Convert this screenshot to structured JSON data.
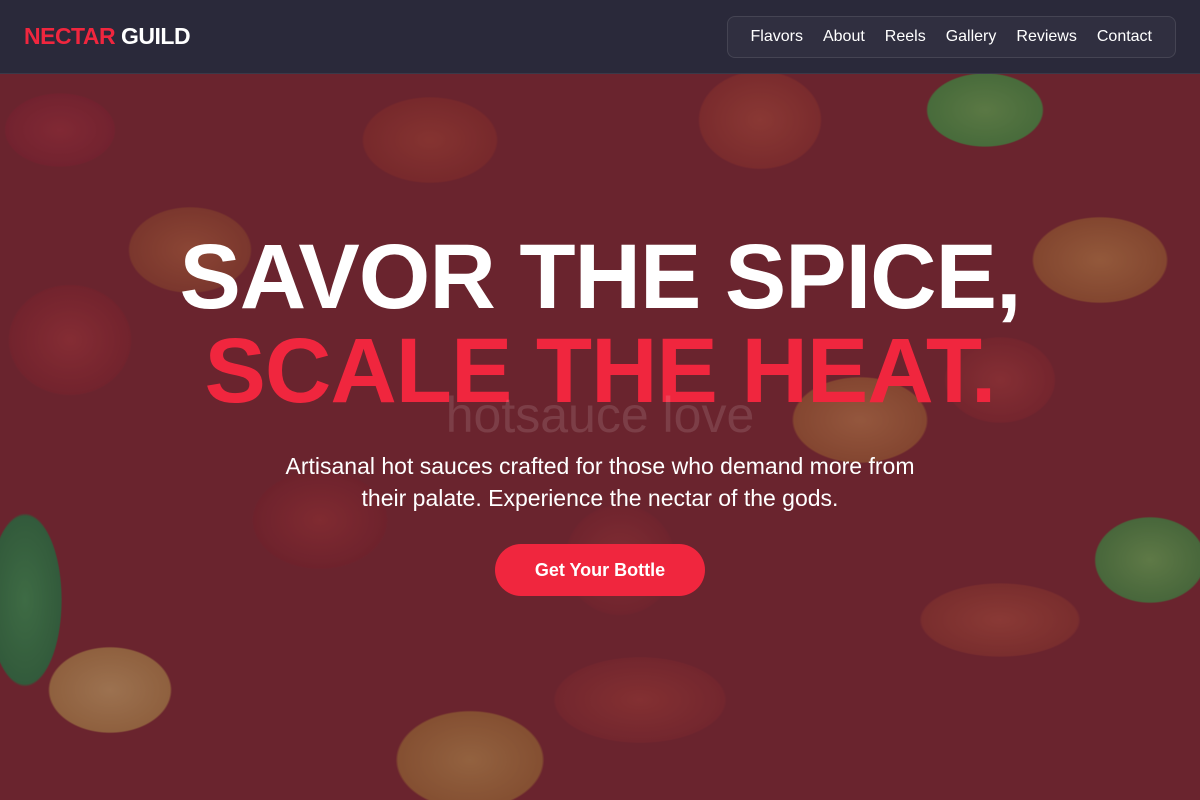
{
  "brand": {
    "accent": "NECTAR",
    "plain": "GUILD",
    "accent_color": "#f0263e"
  },
  "nav": {
    "items": [
      {
        "label": "Flavors"
      },
      {
        "label": "About"
      },
      {
        "label": "Reels"
      },
      {
        "label": "Gallery"
      },
      {
        "label": "Reviews"
      },
      {
        "label": "Contact"
      }
    ]
  },
  "hero": {
    "headline_line1": "SAVOR THE SPICE,",
    "headline_line2": "SCALE THE HEAT.",
    "watermark": "hotsauce love",
    "subtext": "Artisanal hot sauces crafted for those who demand more from their palate. Experience the nectar of the gods.",
    "cta_label": "Get Your Bottle",
    "background": "chili-peppers-photo"
  }
}
